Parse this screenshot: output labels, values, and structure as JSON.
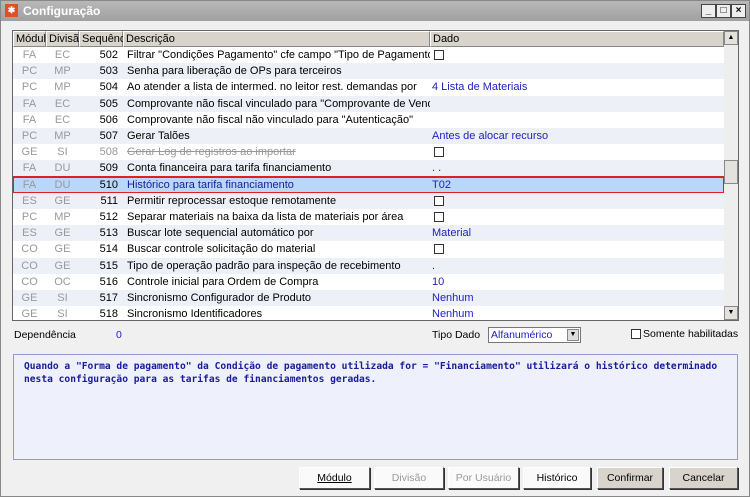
{
  "window": {
    "title": "Configuração",
    "icon": "app-icon",
    "controls": [
      "minimize",
      "maximize",
      "close"
    ]
  },
  "grid": {
    "columns": [
      "Módulo",
      "Divisão",
      "Sequência",
      "Descrição",
      "Dado"
    ],
    "rows": [
      {
        "modulo": "FA",
        "divisao": "EC",
        "seq": "502",
        "desc": "Filtrar \"Condições Pagamento\" cfe campo \"Tipo de Pagamento\"",
        "dado": "",
        "checkbox": true
      },
      {
        "modulo": "PC",
        "divisao": "MP",
        "seq": "503",
        "desc": "Senha para liberação de OPs para terceiros",
        "dado": ""
      },
      {
        "modulo": "PC",
        "divisao": "MP",
        "seq": "504",
        "desc": "Ao atender a lista de intermed. no leitor rest. demandas por",
        "dado": "4 Lista de Materiais"
      },
      {
        "modulo": "FA",
        "divisao": "EC",
        "seq": "505",
        "desc": "Comprovante não fiscal vinculado para \"Comprovante de Venda\"",
        "dado": ""
      },
      {
        "modulo": "FA",
        "divisao": "EC",
        "seq": "506",
        "desc": "Comprovante não fiscal não vinculado para \"Autenticação\"",
        "dado": ""
      },
      {
        "modulo": "PC",
        "divisao": "MP",
        "seq": "507",
        "desc": "Gerar Talões",
        "dado": "Antes de alocar recurso"
      },
      {
        "modulo": "GE",
        "divisao": "SI",
        "seq": "508",
        "desc": "Gerar Log de registros ao importar",
        "dado": "",
        "checkbox": true,
        "disabled": true
      },
      {
        "modulo": "FA",
        "divisao": "DU",
        "seq": "509",
        "desc": "Conta financeira para tarifa financiamento",
        "dado": " . ."
      },
      {
        "modulo": "FA",
        "divisao": "DU",
        "seq": "510",
        "desc": "Histórico para tarifa financiamento",
        "dado": "T02",
        "selected": true
      },
      {
        "modulo": "ES",
        "divisao": "GE",
        "seq": "511",
        "desc": "Permitir reprocessar estoque remotamente",
        "dado": "",
        "checkbox": true
      },
      {
        "modulo": "PC",
        "divisao": "MP",
        "seq": "512",
        "desc": "Separar materiais na baixa da lista de materiais por área",
        "dado": "",
        "checkbox": true
      },
      {
        "modulo": "ES",
        "divisao": "GE",
        "seq": "513",
        "desc": "Buscar lote sequencial automático por",
        "dado": "Material"
      },
      {
        "modulo": "CO",
        "divisao": "GE",
        "seq": "514",
        "desc": "Buscar controle solicitação do material",
        "dado": "",
        "checkbox": true
      },
      {
        "modulo": "CO",
        "divisao": "GE",
        "seq": "515",
        "desc": "Tipo de operação padrão para inspeção de recebimento",
        "dado": " ."
      },
      {
        "modulo": "CO",
        "divisao": "OC",
        "seq": "516",
        "desc": "Controle inicial para Ordem de Compra",
        "dado": "10"
      },
      {
        "modulo": "GE",
        "divisao": "SI",
        "seq": "517",
        "desc": "Sincronismo Configurador de Produto",
        "dado": " Nenhum"
      },
      {
        "modulo": "GE",
        "divisao": "SI",
        "seq": "518",
        "desc": "Sincronismo Identificadores",
        "dado": " Nenhum"
      }
    ]
  },
  "footer": {
    "dependencia_label": "Dependência",
    "dependencia_value": "0",
    "tipo_dado_label": "Tipo Dado",
    "tipo_dado_value": "Alfanumérico",
    "somente_label": "Somente habilitadas",
    "somente_checked": false
  },
  "description": "Quando a \"Forma de pagamento\" da Condição de pagamento utilizada for = \"Financiamento\" utilizará o histórico determinado nesta configuração para as tarifas de financiamentos geradas.",
  "buttons": {
    "modulo": "Módulo",
    "divisao": "Divisão",
    "por_usuario": "Por Usuário",
    "historico": "Histórico",
    "confirmar": "Confirmar",
    "cancelar": "Cancelar"
  },
  "colors": {
    "selection": "#b8d8f8",
    "highlight_border": "#e02020",
    "value_text": "#2020c0"
  }
}
